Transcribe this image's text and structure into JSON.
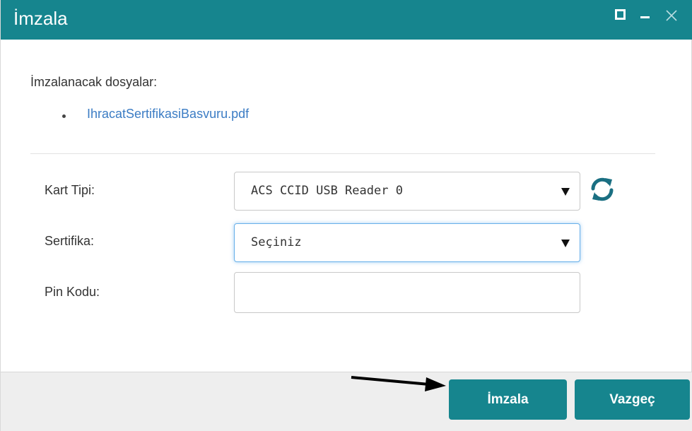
{
  "window": {
    "title": "İmzala",
    "accent_color": "#16858e",
    "controls": [
      "maximize-icon",
      "minimize-icon",
      "close-icon"
    ]
  },
  "files": {
    "label": "İmzalanacak dosyalar:",
    "items": [
      "IhracatSertifikasiBasvuru.pdf"
    ],
    "link_color": "#3b7cc4"
  },
  "form": {
    "card_type": {
      "label": "Kart Tipi:",
      "value": "ACS CCID USB Reader 0",
      "refresh_icon": "refresh-icon"
    },
    "certificate": {
      "label": "Sertifika:",
      "value": "Seçiniz"
    },
    "pin": {
      "label": "Pin Kodu:",
      "value": ""
    }
  },
  "footer": {
    "sign_label": "İmzala",
    "cancel_label": "Vazgeç"
  }
}
